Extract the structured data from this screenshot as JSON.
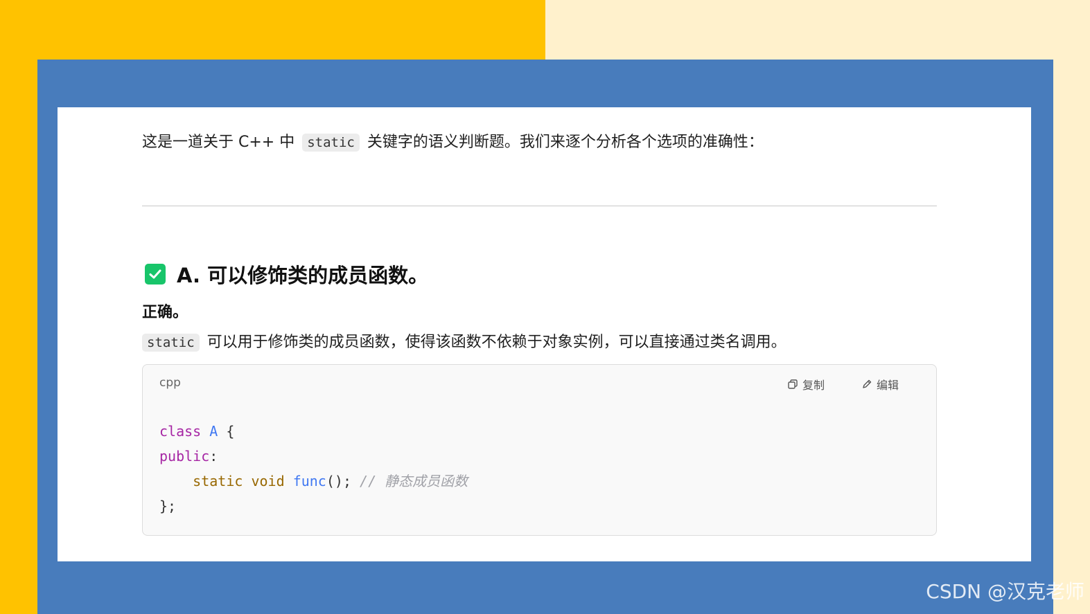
{
  "intro": {
    "before": "这是一道关于 C++ 中",
    "keyword": "static",
    "after": "关键字的语义判断题。我们来逐个分析各个选项的准确性："
  },
  "option": {
    "title": "A. 可以修饰类的成员函数。",
    "verdict": "正确。",
    "keyword": "static",
    "explanation": "可以用于修饰类的成员函数，使得该函数不依赖于对象实例，可以直接通过类名调用。"
  },
  "code_block": {
    "language": "cpp",
    "copy_label": "复制",
    "edit_label": "编辑",
    "line1": {
      "kw": "class",
      "name": "A",
      "rest": " {"
    },
    "line2": {
      "kw": "public",
      "rest": ":"
    },
    "line3": {
      "indent": "    ",
      "kw1": "static",
      "kw2": "void",
      "fn": "func",
      "rest": "(); ",
      "comment": "// 静态成员函数"
    },
    "line4": "};"
  },
  "watermark": "CSDN @汉克老师",
  "colors": {
    "left_bg": "#ffc200",
    "right_bg": "#fff1cc",
    "frame": "#487cbc",
    "check": "#18c56a"
  }
}
